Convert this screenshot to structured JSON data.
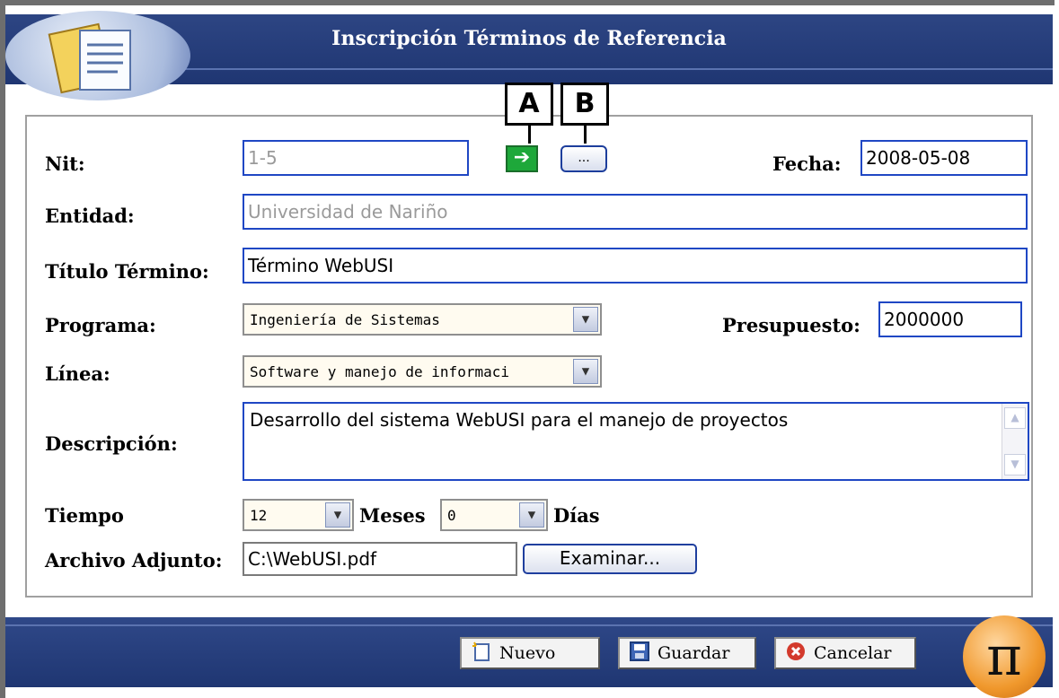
{
  "window": {
    "title": "Inscripción Términos de Referencia"
  },
  "callouts": {
    "a": "A",
    "b": "B"
  },
  "form": {
    "nit_label": "Nit:",
    "nit_value": "1-5",
    "go_button_icon": "arrow-right-icon",
    "lookup_button_label": "...",
    "fecha_label": "Fecha:",
    "fecha_value": "2008-05-08",
    "entidad_label": "Entidad:",
    "entidad_value": "Universidad de Nariño",
    "titulo_label": "Título Término:",
    "titulo_value": "Término WebUSI",
    "programa_label": "Programa:",
    "programa_selected": "Ingeniería de Sistemas",
    "presupuesto_label": "Presupuesto:",
    "presupuesto_value": "2000000",
    "linea_label": "Línea:",
    "linea_selected": "Software y manejo de informaci",
    "descripcion_label": "Descripción:",
    "descripcion_value": "Desarrollo del sistema WebUSI para el manejo de proyectos",
    "tiempo_label": "Tiempo",
    "meses_selected": "12",
    "meses_label": "Meses",
    "dias_selected": "0",
    "dias_label": "Días",
    "archivo_label": "Archivo Adjunto:",
    "archivo_value": "C:\\WebUSI.pdf",
    "examinar_label": "Examinar..."
  },
  "footer": {
    "nuevo_label": "Nuevo",
    "guardar_label": "Guardar",
    "cancelar_label": "Cancelar",
    "logo_symbol": "π"
  },
  "colors": {
    "header": "#1f3672",
    "input_border": "#1f47c4",
    "accent_green": "#1ea83a",
    "logo_orange": "#f0982c"
  }
}
